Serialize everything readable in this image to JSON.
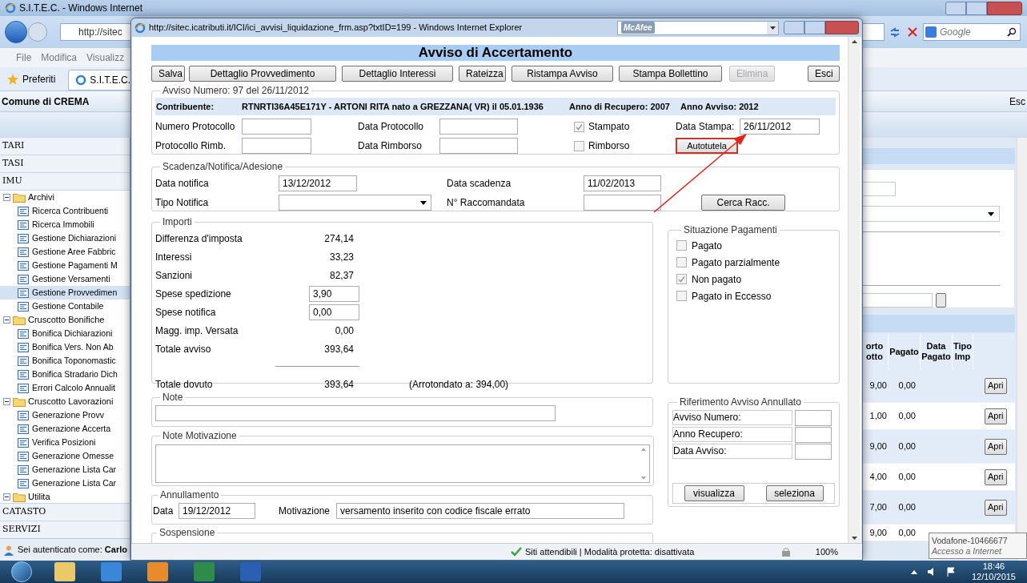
{
  "background_window": {
    "title": "S.I.T.E.C. - Windows Internet",
    "address": "http://sitec",
    "menu": [
      "File",
      "Modifica",
      "Visualizz"
    ],
    "favorites": "Preferiti",
    "tab": "S.I.T.E.C.",
    "search_placeholder": "Google",
    "header": "Comune di CREMA",
    "header_right": "Esc",
    "sidebar": {
      "top_sections": [
        "TARI",
        "TASI",
        "IMU"
      ],
      "tree": [
        {
          "label": "Archivi",
          "expanded": true,
          "children": [
            {
              "label": "Ricerca Contribuenti",
              "selected": false
            },
            {
              "label": "Ricerca Immobili",
              "selected": false
            },
            {
              "label": "Gestione Dichiarazioni",
              "selected": false
            },
            {
              "label": "Gestione Aree Fabbric",
              "selected": false
            },
            {
              "label": "Gestione Pagamenti M",
              "selected": false
            },
            {
              "label": "Gestione Versamenti",
              "selected": false
            },
            {
              "label": "Gestione Provvedimen",
              "selected": true
            },
            {
              "label": "Gestione Contabile",
              "selected": false
            }
          ]
        },
        {
          "label": "Cruscotto Bonifiche",
          "expanded": true,
          "children": [
            {
              "label": "Bonifica Dichiarazioni",
              "selected": false
            },
            {
              "label": "Bonifica Vers. Non Ab",
              "selected": false
            },
            {
              "label": "Bonifica Toponomastic",
              "selected": false
            },
            {
              "label": "Bonifica Stradario Dich",
              "selected": false
            },
            {
              "label": "Errori Calcolo Annualit",
              "selected": false
            }
          ]
        },
        {
          "label": "Cruscotto Lavorazioni",
          "expanded": true,
          "children": [
            {
              "label": "Generazione Provv",
              "selected": false
            },
            {
              "label": "Generazione Accerta",
              "selected": false
            },
            {
              "label": "Verifica Posizioni",
              "selected": false
            },
            {
              "label": "Generazione Omesse",
              "selected": false
            },
            {
              "label": "Generazione Lista Car",
              "selected": false
            },
            {
              "label": "Generazione Lista Car",
              "selected": false
            }
          ]
        },
        {
          "label": "Utilita",
          "expanded": true
        }
      ],
      "bottom_sections": [
        "CATASTO",
        "SERVIZI"
      ]
    },
    "user_status": "Sei autenticato come: **Carlo**",
    "table": {
      "columns": [
        "orto otto",
        "Pagato",
        "Data Pagato",
        "Tipo Imp"
      ],
      "rows": [
        {
          "column_1": "9,00",
          "pagato": "0,00",
          "action": "Apri"
        },
        {
          "column_1": "1,00",
          "pagato": "0,00",
          "action": "Apri"
        },
        {
          "column_1": "9,00",
          "pagato": "0,00",
          "action": "Apri"
        },
        {
          "column_1": "4,00",
          "pagato": "0,00",
          "action": "Apri"
        },
        {
          "column_1": "7,00",
          "pagato": "0,00",
          "action": "Apri"
        },
        {
          "column_1": "9,00",
          "pagato": "0,00"
        }
      ]
    },
    "tooltip": {
      "title": "Vodafone-10466677",
      "subtitle": "Accesso a Internet"
    }
  },
  "popup": {
    "title": "http://sitec.icatributi.it/ICI/ici_avvisi_liquidazione_frm.asp?txtID=199 - Windows Internet Explorer",
    "toolbar_logo": "McAfee",
    "heading": "Avviso di Accertamento",
    "buttons": [
      {
        "label": "Salva",
        "disabled": false
      },
      {
        "label": "Dettaglio Provvedimento",
        "disabled": false
      },
      {
        "label": "Dettaglio Interessi",
        "disabled": false
      },
      {
        "label": "Rateizza",
        "disabled": false
      },
      {
        "label": "Ristampa Avviso",
        "disabled": false
      },
      {
        "label": "Stampa Bollettino",
        "disabled": false
      },
      {
        "label": "Elimina",
        "disabled": true
      },
      {
        "label": "Esci",
        "disabled": false
      }
    ],
    "avviso": {
      "legend": "Avviso Numero: 97 del 26/11/2012",
      "contribuente_label": "Contribuente:",
      "contribuente": "RTNRTI36A45E171Y - ARTONI RITA nato a GREZZANA( VR) il 05.01.1936",
      "anno_recupero": "Anno di Recupero: 2007",
      "anno_avviso": "Anno Avviso: 2012",
      "fields": [
        {
          "label": "Numero Protocollo"
        },
        {
          "label": "Data Protocollo"
        },
        {
          "label": "Protocollo Rimb."
        },
        {
          "label": "Data Rimborso"
        }
      ],
      "checkboxes": [
        {
          "label": "Stampato",
          "checked": true
        },
        {
          "label": "Rimborso",
          "checked": false
        }
      ],
      "data_stampa": {
        "label": "Data Stampa:",
        "value": "26/11/2012"
      },
      "autotutela_button": "Autotutela"
    },
    "scadenza": {
      "legend": "Scadenza/Notifica/Adesione",
      "data_notifica": {
        "label": "Data notifica",
        "value": "13/12/2012"
      },
      "data_scadenza": {
        "label": "Data scadenza",
        "value": "11/02/2013"
      },
      "tipo_notifica": {
        "label": "Tipo Notifica"
      },
      "raccomandata": {
        "label": "N° Raccomandata"
      },
      "search_button": "Cerca Racc."
    },
    "importi": {
      "legend": "Importi",
      "rows": [
        {
          "kind": "text",
          "label": "Differenza d'imposta",
          "value": "274,14"
        },
        {
          "kind": "text",
          "label": "Interessi",
          "value": "33,23"
        },
        {
          "kind": "text",
          "label": "Sanzioni",
          "value": "82,37"
        },
        {
          "kind": "input",
          "label": "Spese spedizione",
          "value": "3,90"
        },
        {
          "kind": "input",
          "label": "Spese notifica",
          "value": "0,00"
        },
        {
          "kind": "text",
          "label": "Magg. imp. Versata",
          "value": "0,00"
        },
        {
          "kind": "text",
          "label": "Totale avviso",
          "value": "393,64"
        }
      ],
      "total": {
        "label": "Totale dovuto",
        "value": "393,64",
        "note": "(Arrotondato a: 394,00)"
      }
    },
    "situazione": {
      "legend": "Situazione Pagamenti",
      "options": [
        {
          "label": "Pagato",
          "checked": false
        },
        {
          "label": "Pagato parzialmente",
          "checked": false
        },
        {
          "label": "Non pagato",
          "checked": true
        },
        {
          "label": "Pagato in Eccesso",
          "checked": false
        }
      ]
    },
    "note": {
      "legend": "Note"
    },
    "note_motivazione": {
      "legend": "Note Motivazione"
    },
    "riferimento": {
      "legend": "Riferimento Avviso Annullato",
      "fields": [
        "Avviso Numero:",
        "Anno Recupero:",
        "Data Avviso:"
      ],
      "buttons": [
        "visualizza",
        "seleziona"
      ]
    },
    "annullamento": {
      "legend": "Annullamento",
      "data": {
        "label": "Data",
        "value": "19/12/2012"
      },
      "motivazione": {
        "label": "Motivazione",
        "value": "versamento inserito con codice fiscale errato"
      }
    },
    "sospensione": {
      "legend": "Sospensione"
    },
    "status_bar": {
      "zone": "Siti attendibili | Modalità protetta: disattivata",
      "zoom": "100%"
    }
  },
  "taskbar": {
    "time": "18:46",
    "date": "12/10/2015"
  }
}
